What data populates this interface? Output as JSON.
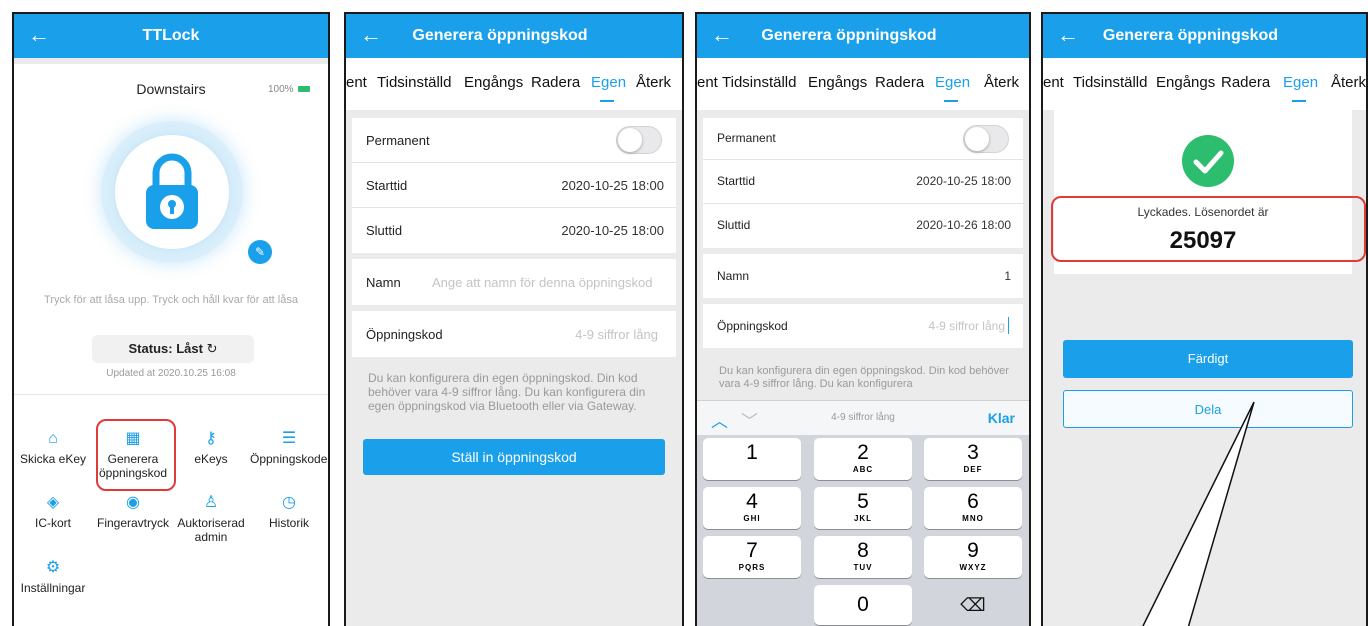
{
  "screen1": {
    "title": "TTLock",
    "lock_name": "Downstairs",
    "battery": "100%",
    "hint": "Tryck för att låsa upp. Tryck och håll kvar för att låsa",
    "status_label": "Status:",
    "status_value": "Låst",
    "updated": "Updated at 2020.10.25 16:08",
    "menu": [
      {
        "label": "Skicka eKey",
        "icon": "ekey-send-icon"
      },
      {
        "label": "Generera öppningskod",
        "icon": "keypad-icon"
      },
      {
        "label": "eKeys",
        "icon": "ekeys-icon"
      },
      {
        "label": "Öppningskoder",
        "icon": "passcodes-list-icon"
      },
      {
        "label": "IC-kort",
        "icon": "ic-card-icon"
      },
      {
        "label": "Fingeravtryck",
        "icon": "fingerprint-icon"
      },
      {
        "label": "Auktoriserad admin",
        "icon": "admin-user-icon"
      },
      {
        "label": "Historik",
        "icon": "history-icon"
      },
      {
        "label": "Inställningar",
        "icon": "settings-gear-icon"
      }
    ]
  },
  "screen2": {
    "title": "Generera öppningskod",
    "tabs": [
      "ent",
      "Tidsinställd",
      "Engångs",
      "Radera",
      "Egen",
      "Återk"
    ],
    "active_tab": "Egen",
    "permanent_label": "Permanent",
    "start_label": "Starttid",
    "start_value": "2020-10-25 18:00",
    "end_label": "Sluttid",
    "end_value": "2020-10-25 18:00",
    "name_label": "Namn",
    "name_placeholder": "Ange att namn för denna öppningskod",
    "code_label": "Öppningskod",
    "code_placeholder": "4-9 siffror lång",
    "help": "Du kan konfigurera din egen öppningskod. Din kod behöver vara 4-9 siffror lång. Du kan konfigurera din egen öppningskod via Bluetooth eller via Gateway.",
    "submit": "Ställ in öppningskod"
  },
  "screen3": {
    "title": "Generera öppningskod",
    "permanent_label": "Permanent",
    "start_label": "Starttid",
    "start_value": "2020-10-25 18:00",
    "end_label": "Sluttid",
    "end_value": "2020-10-26 18:00",
    "name_label": "Namn",
    "name_value": "1",
    "code_label": "Öppningskod",
    "code_placeholder": "4-9 siffror lång",
    "help": "Du kan konfigurera din egen öppningskod. Din kod behöver vara 4-9 siffror lång. Du kan konfigurera",
    "keyboard_hint": "4-9 siffror lång",
    "keyboard_done": "Klar",
    "keys": [
      {
        "n": "1",
        "l": ""
      },
      {
        "n": "2",
        "l": "ABC"
      },
      {
        "n": "3",
        "l": "DEF"
      },
      {
        "n": "4",
        "l": "GHI"
      },
      {
        "n": "5",
        "l": "JKL"
      },
      {
        "n": "6",
        "l": "MNO"
      },
      {
        "n": "7",
        "l": "PQRS"
      },
      {
        "n": "8",
        "l": "TUV"
      },
      {
        "n": "9",
        "l": "WXYZ"
      },
      {
        "n": "0",
        "l": ""
      }
    ]
  },
  "screen4": {
    "title": "Generera öppningskod",
    "success_text": "Lyckades. Lösenordet är",
    "code": "25097",
    "done": "Färdigt",
    "share": "Dela"
  },
  "colors": {
    "accent": "#1aa0ea",
    "success": "#2dbd6e",
    "highlight": "#e13a3a"
  }
}
